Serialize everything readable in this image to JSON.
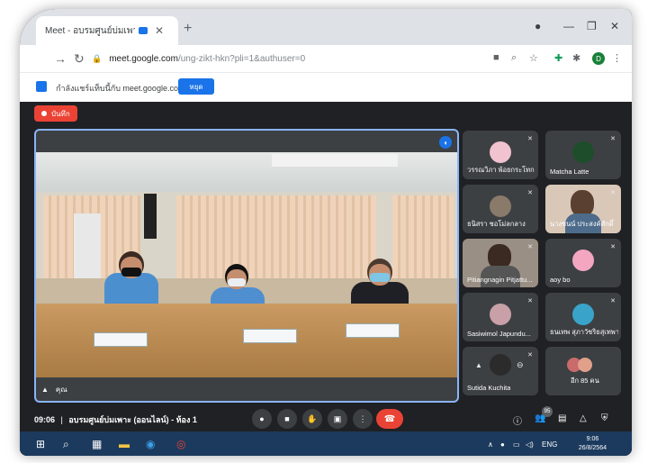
{
  "browser": {
    "tab_title": "Meet - อบรมศูนย์บ่มเพาะ (ออนไลน์",
    "new_tab": "+",
    "url_host": "meet.google.com",
    "url_path": "/ung-zikt-hkn?pli=1&authuser=0",
    "profile_initial": "D"
  },
  "infobar": {
    "message": "กำลังแชร์แท็บนี้กับ meet.google.com",
    "stop_label": "หยุด"
  },
  "meet": {
    "recording_label": "บันทึก",
    "self_label": "คุณ",
    "time": "09:06",
    "meeting_title": "อบรมศูนย์บ่มเพาะ (ออนไลน์) - ห้อง 1",
    "participant_count": "95",
    "tiles": [
      {
        "name": "วรรณวิภา พ้อยกระโทก",
        "color": "#f1c2cf"
      },
      {
        "name": "Matcha Latte",
        "color": "#1e4d2b"
      },
      {
        "name": "ธนิสรา ชอโม่ลกลาง",
        "color": "#7a6a5a"
      },
      {
        "name": "นางชนน์ ประสงค์ศักดิ์",
        "color": "#d9c8b8"
      },
      {
        "name": "Pitiangnagin Pitjattu...",
        "color": "#8a7f74"
      },
      {
        "name": "aoy bo",
        "color": "#f4a6c0"
      },
      {
        "name": "Sasiwimol Japundu...",
        "color": "#c9a0a8"
      },
      {
        "name": "ธนเทพ สุภาวัชริยสุเทพา",
        "color": "#3aa3c9"
      },
      {
        "name": "Sutida Kuchita",
        "color": "#2b2b2b"
      },
      {
        "name": "อีก 85 คน",
        "color": "#c96b6b"
      }
    ]
  },
  "taskbar": {
    "language": "ENG",
    "time": "9:06",
    "date": "26/8/2564"
  },
  "colors": {
    "meet_bg": "#202124",
    "accent": "#1a73e8",
    "record": "#ea4335"
  }
}
